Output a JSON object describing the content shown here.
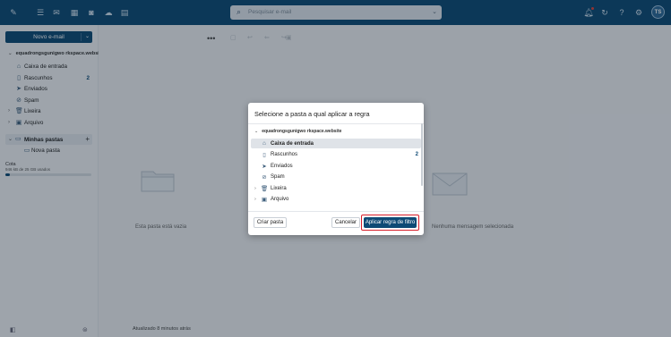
{
  "topbar": {
    "search_placeholder": "Pesquisar e-mail",
    "avatar_initials": "TS",
    "colors": {
      "bar": "#0e4a75",
      "accent": "#0e4a75"
    }
  },
  "sidebar": {
    "new_mail_label": "Novo e-mail",
    "account": "equadrongsgunigwo rkspace.website",
    "folders": [
      {
        "label": "Caixa de entrada",
        "icon": "inbox-icon",
        "count": ""
      },
      {
        "label": "Rascunhos",
        "icon": "draft-icon",
        "count": "2"
      },
      {
        "label": "Enviados",
        "icon": "send-icon",
        "count": ""
      },
      {
        "label": "Spam",
        "icon": "spam-icon",
        "count": ""
      },
      {
        "label": "Lixeira",
        "icon": "trash-icon",
        "count": ""
      },
      {
        "label": "Arquivo",
        "icon": "archive-icon",
        "count": ""
      }
    ],
    "my_folders_label": "Minhas pastas",
    "new_folder_label": "Nova pasta",
    "quota_label": "Cota",
    "quota_detail": "946 kB de 25 GB usados",
    "quota_fraction": 0.05
  },
  "list": {
    "empty_text": "Esta pasta está vazia",
    "updated_text": "Atualizado 8 minutos atrás"
  },
  "reader": {
    "no_message_text": "Nenhuma mensagem selecionada"
  },
  "modal": {
    "title": "Selecione a pasta a qual aplicar a regra",
    "account": "equadrongsgunigwo rkspace.website",
    "folders": [
      {
        "label": "Caixa de entrada",
        "icon": "inbox-icon",
        "count": ""
      },
      {
        "label": "Rascunhos",
        "icon": "draft-icon",
        "count": "2"
      },
      {
        "label": "Enviados",
        "icon": "send-icon",
        "count": ""
      },
      {
        "label": "Spam",
        "icon": "spam-icon",
        "count": ""
      },
      {
        "label": "Lixeira",
        "icon": "trash-icon",
        "count": ""
      },
      {
        "label": "Arquivo",
        "icon": "archive-icon",
        "count": ""
      }
    ],
    "create_folder_label": "Criar pasta",
    "cancel_label": "Cancelar",
    "apply_label": "Aplicar regra de filtro"
  }
}
